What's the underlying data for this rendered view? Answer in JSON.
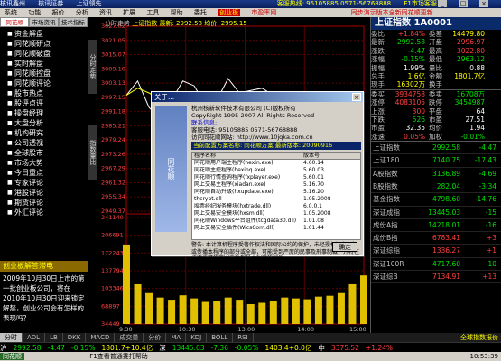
{
  "titlebar": {
    "items": [
      "核讯鑫州",
      "核讯证券",
      "上证领先"
    ],
    "hotline": "客服热线: 95105885 0571-56768888",
    "tag": "F1市场客服"
  },
  "menubar": {
    "items": [
      "系统",
      "功能",
      "报价",
      "分析",
      "资讯",
      "扩展",
      "工具",
      "帮助",
      "委托"
    ],
    "tag": "创业板",
    "news": "市盈率网",
    "link": "同步演示版本全新同花顺更新"
  },
  "leftpanel": {
    "tabs": [
      "同花顺",
      "市场资讯",
      "技术指标"
    ],
    "items": [
      "资金解盘",
      "同花顺研点",
      "同花顺破盘",
      "实时解盘",
      "同花顺控盘",
      "同花顺评论",
      "股市热点",
      "股评点评",
      "操盘经理",
      "大盘分析",
      "机构研究",
      "公司透视",
      "全球股市",
      "市场大势",
      "今日重点",
      "专家评论",
      "港股评论",
      "期货评论",
      "外汇评论"
    ],
    "news_title": "创业板解答滞电",
    "news_body": "2009年10月30日上市的第一批创业板公司，将在2010年10月30日迎来锁定解禁，创业公司会有怎样的表现吗？"
  },
  "chart": {
    "title_a": "分时走势",
    "title_b": "上证指数 最新: 2992.58 均价: 2995.15",
    "yticks": [
      "3027.02",
      "3021.05",
      "3015.07",
      "3009.10",
      "3003.13",
      "2997.15",
      "2991.18",
      "2985.21",
      "2979.24",
      "2973.26",
      "2967.29",
      "2961.32",
      "2955.34",
      "2949.37"
    ],
    "vticks": [
      "241140",
      "206691",
      "172243",
      "137794",
      "103346",
      "68897",
      "34449"
    ],
    "xticks": [
      "9:30",
      "10:30",
      "13:00",
      "14:00",
      "15:00"
    ],
    "side_tab_top": "分时走势",
    "side_tab_mid": "指数量比"
  },
  "chart_data": {
    "type": "line",
    "title": "上证指数",
    "ylim": [
      2949.37,
      3027.02
    ],
    "series": [
      {
        "name": "上证指数",
        "values": [
          2998,
          3004,
          2993,
          2988,
          2996,
          3004,
          3002,
          2994,
          2996,
          3005,
          2999,
          3000,
          3001,
          2998,
          2991,
          2992,
          2996,
          2999,
          2997,
          2995,
          2993,
          2992.58
        ]
      },
      {
        "name": "均价",
        "values": [
          2998,
          3001,
          2999,
          2996,
          2996,
          2998,
          2998,
          2997,
          2997,
          2998,
          2998,
          2998,
          2999,
          2998,
          2997,
          2997,
          2997,
          2997,
          2996,
          2996,
          2995.5,
          2995.15
        ]
      }
    ],
    "volume": [
      180000,
      90000,
      70000,
      60000,
      55000,
      65000,
      58000,
      50000,
      52000,
      60000,
      55000,
      45000,
      48000,
      52000,
      60000,
      58000,
      56000,
      62000,
      64000,
      70000,
      90000,
      110000
    ]
  },
  "rightpanel": {
    "header": "上证指数 1A0001",
    "quote": [
      {
        "l1": "委比",
        "v1": "+1.84%",
        "c1": "red",
        "l2": "委差",
        "v2": "14479.80",
        "c2": "yel"
      },
      {
        "l1": "最新",
        "v1": "2992.58",
        "c1": "grn",
        "l2": "开盘",
        "v2": "2996.97",
        "c2": "red"
      },
      {
        "l1": "涨跌",
        "v1": "-4.47",
        "c1": "grn",
        "l2": "最高",
        "v2": "3022.80",
        "c2": "red"
      },
      {
        "l1": "涨幅",
        "v1": "-0.15%",
        "c1": "grn",
        "l2": "最低",
        "v2": "2963.12",
        "c2": "grn"
      },
      {
        "l1": "振幅",
        "v1": "1.99%",
        "c1": "wht",
        "l2": "量比",
        "v2": "0.88",
        "c2": "wht"
      },
      {
        "l1": "总手",
        "v1": "1.6亿",
        "c1": "yel",
        "l2": "金额",
        "v2": "1801.7亿",
        "c2": "yel"
      },
      {
        "l1": "现手",
        "v1": "16302万",
        "c1": "yel",
        "l2": "换手",
        "v2": "",
        "c2": "wht"
      }
    ],
    "quote2": [
      {
        "l1": "委买",
        "v1": "3934758",
        "c1": "red",
        "l2": "委卖",
        "v2": "16708万",
        "c2": "grn"
      },
      {
        "l1": "涨停",
        "v1": "4083105",
        "c1": "red",
        "l2": "跌停",
        "v2": "3454987",
        "c2": "grn"
      },
      {
        "l1": "上涨",
        "v1": "300",
        "c1": "red",
        "l2": "平盘",
        "v2": "64",
        "c2": "wht"
      },
      {
        "l1": "下跌",
        "v1": "526",
        "c1": "grn",
        "l2": "市盈",
        "v2": "27.51",
        "c2": "wht"
      },
      {
        "l1": "市盈",
        "v1": "32.35",
        "c1": "wht",
        "l2": "均价",
        "v2": "1.94",
        "c2": "wht"
      },
      {
        "l1": "涨速",
        "v1": "0.05%",
        "c1": "red",
        "l2": "加权",
        "v2": "-0.01%",
        "c2": "grn"
      }
    ],
    "indices": [
      {
        "name": "上证指数",
        "price": "2992.58",
        "change": "-4.47"
      },
      {
        "name": "上证180",
        "price": "7140.75",
        "change": "-17.43"
      },
      {
        "name": "A股指数",
        "price": "3136.89",
        "change": "-4.69"
      },
      {
        "name": "B股指数",
        "price": "282.04",
        "change": "-3.34"
      },
      {
        "name": "基金指数",
        "price": "4798.60",
        "change": "-14.76"
      },
      {
        "name": "深证成指",
        "price": "13445.03",
        "change": "-15"
      },
      {
        "name": "成份A指",
        "price": "14218.01",
        "change": "-16"
      },
      {
        "name": "成份B指",
        "price": "6783.41",
        "change": "+3"
      },
      {
        "name": "深证综指",
        "price": "1336.27",
        "change": "+1"
      },
      {
        "name": "深证100R",
        "price": "4717.60",
        "change": "-10"
      },
      {
        "name": "深证综B",
        "price": "7134.91",
        "change": "+13"
      }
    ]
  },
  "bottomtabs": {
    "items": [
      "分时",
      "ADL",
      "LB",
      "DKK",
      "MACD",
      "成交量",
      "分价",
      "MA",
      "KDJ",
      "BOLL",
      "RSI"
    ],
    "active_index": 0,
    "right": "全球指数报价"
  },
  "statusbar": {
    "items": [
      {
        "t": "沪",
        "c": "wht"
      },
      {
        "t": "2992.58",
        "c": "grn"
      },
      {
        "t": "-4.47",
        "c": "grn"
      },
      {
        "t": "-0.15%",
        "c": "grn"
      },
      {
        "t": "1801.7+10.4亿",
        "c": "yel"
      },
      {
        "t": "深",
        "c": "wht"
      },
      {
        "t": "13445.03",
        "c": "grn"
      },
      {
        "t": "-7.36",
        "c": "grn"
      },
      {
        "t": "-0.05%",
        "c": "grn"
      },
      {
        "t": "1403.4+0.0亿",
        "c": "yel"
      },
      {
        "t": "中",
        "c": "wht"
      },
      {
        "t": "3375.52",
        "c": "red"
      },
      {
        "t": "+1.24%",
        "c": "red"
      }
    ]
  },
  "bottombar": {
    "start": "同花顺",
    "message": "F1查看普通委托帮助",
    "time": "10:53:39"
  },
  "dialog": {
    "title": "关于...",
    "close": "×",
    "logo": "同花顺",
    "info_lines": [
      "杭州核新软件技术有限公司 (C)版权所有",
      "CopyRight 1995-2007 All Rights Reserved",
      "",
      "联系信息:",
      "客服电话: 95105885 0571-56768888",
      "访问同花顺网站: http://www.10jqka.com.cn"
    ],
    "notice": "当前配置方案名称: 同花顺方案    最新版本: 20090916",
    "table_head": [
      "程序名称",
      "版本号"
    ],
    "table_rows": [
      [
        "同花顺用户端主程序(hexin.exe)",
        "4.60.14"
      ],
      [
        "同花顺主控程序(hexinq.exe)",
        "5.60.03"
      ],
      [
        "同花顺行情查询程序(fxplayer.exe)",
        "5.60.01"
      ],
      [
        "网上交易主程序(xiadan.exe)",
        "5.16.70"
      ],
      [
        "同花顺自动升级(hxupdate.exe)",
        "5.16.20"
      ],
      [
        "thcrypt.dll",
        "1.05.2008"
      ],
      [
        "股票经纪服务模块(hxtrade.dll)",
        "6.0.0.1"
      ],
      [
        "网上交易安全模块(hxsm.dll)",
        "1.05.2008"
      ],
      [
        "同花顺Windows平台组件(tcgdata30.dll)",
        "1.01.08"
      ],
      [
        "网上交易安全插件(WicsCom.dll)",
        "1.01.44"
      ]
    ],
    "footer": "警告: 本计算机程序受著作权法和国际公约的保护，未经授权擅自复制或传播本程序的部分或全部，可能受到严厉的民事及刑事制裁，并将在法律许可的范围内受到最大程度的起诉。",
    "ok": "确定"
  }
}
